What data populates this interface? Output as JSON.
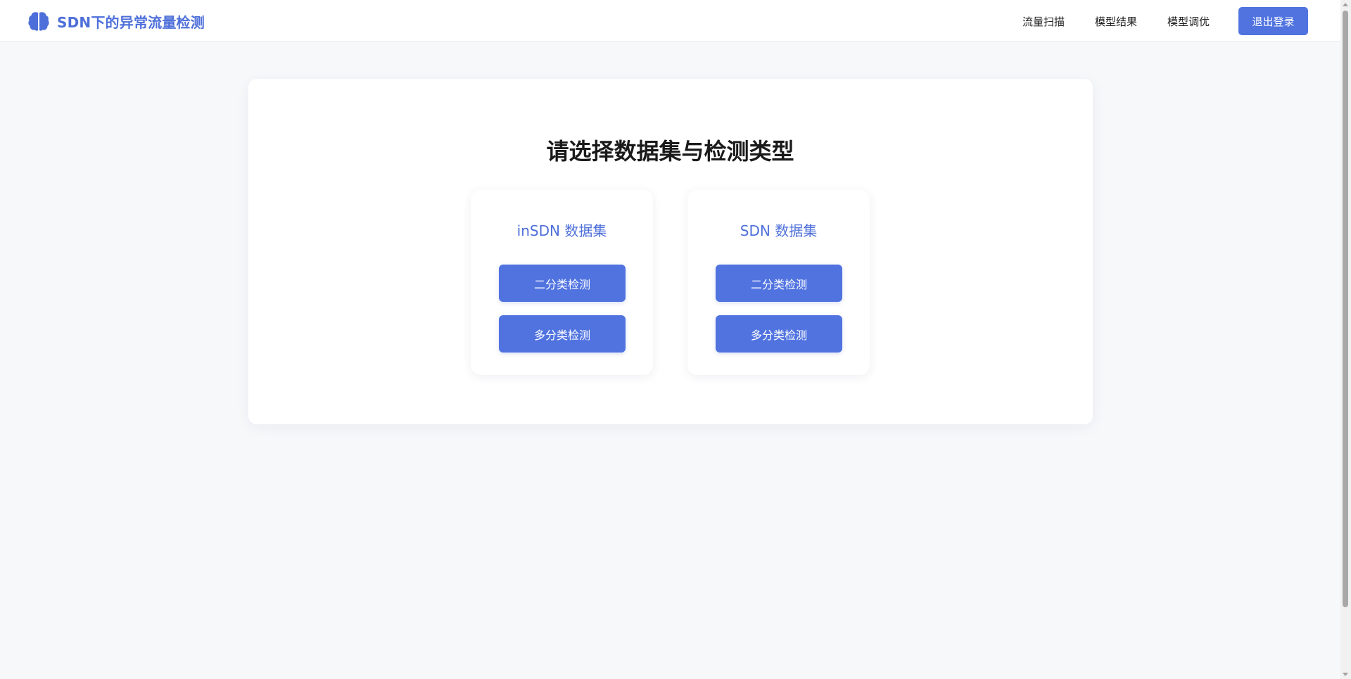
{
  "header": {
    "brand_icon": "brain-icon",
    "brand_title": "SDN下的异常流量检测",
    "nav": [
      {
        "label": "流量扫描"
      },
      {
        "label": "模型结果"
      },
      {
        "label": "模型调优"
      }
    ],
    "logout_label": "退出登录"
  },
  "main": {
    "title": "请选择数据集与检测类型",
    "datasets": [
      {
        "title": "inSDN 数据集",
        "binary_label": "二分类检测",
        "multi_label": "多分类检测"
      },
      {
        "title": "SDN 数据集",
        "binary_label": "二分类检测",
        "multi_label": "多分类检测"
      }
    ]
  },
  "colors": {
    "accent": "#5073e0",
    "brand_text": "#4e6fd9",
    "background": "#f7f8fa"
  }
}
